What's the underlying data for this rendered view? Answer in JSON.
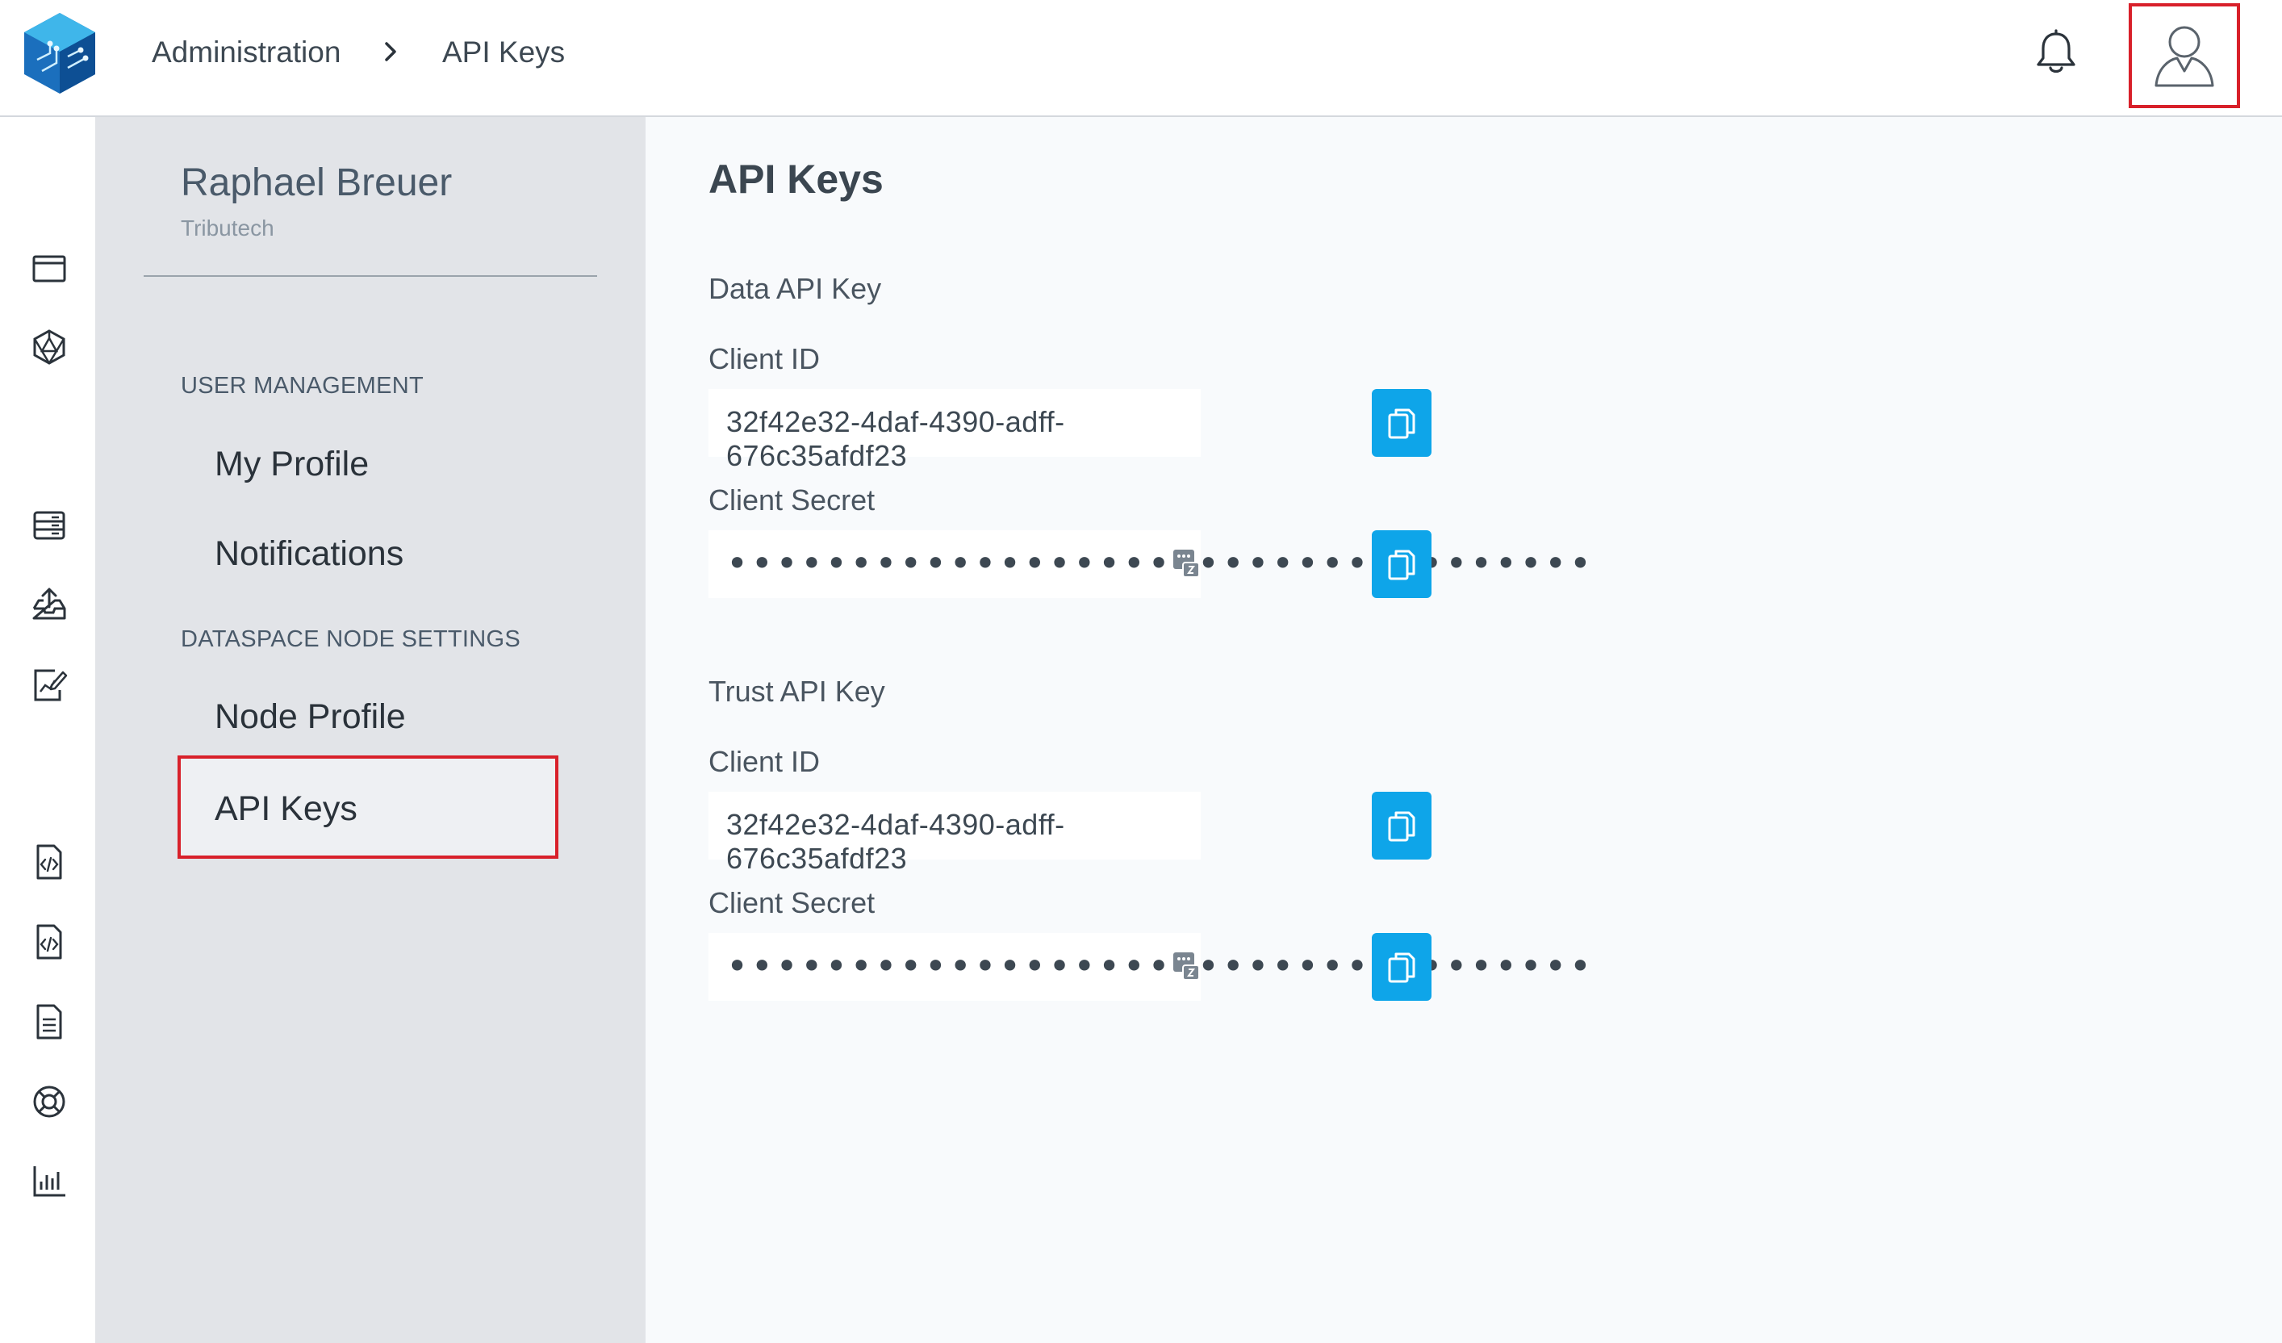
{
  "breadcrumb": {
    "parent": "Administration",
    "current": "API Keys"
  },
  "user": {
    "name": "Raphael Breuer",
    "organization": "Tributech"
  },
  "sidebar": {
    "sections": [
      {
        "title": "USER MANAGEMENT",
        "items": [
          "My Profile",
          "Notifications"
        ]
      },
      {
        "title": "DATASPACE NODE SETTINGS",
        "items": [
          "Node Profile",
          "API Keys"
        ]
      }
    ],
    "active_item": "API Keys"
  },
  "main": {
    "title": "API Keys",
    "groups": [
      {
        "label": "Data API Key",
        "client_id_label": "Client ID",
        "client_id": "32f42e32-4daf-4390-adff-676c35afdf23",
        "client_secret_label": "Client Secret",
        "client_secret_mask": "•••••••••••••••••••••••••••••••••••"
      },
      {
        "label": "Trust API Key",
        "client_id_label": "Client ID",
        "client_id": "32f42e32-4daf-4390-adff-676c35afdf23",
        "client_secret_label": "Client Secret",
        "client_secret_mask": "•••••••••••••••••••••••••••••••••••"
      }
    ]
  },
  "icons": {
    "rail": [
      "window-icon",
      "network-hex-icon",
      "server-icon",
      "upload-tray-icon",
      "edit-chart-icon",
      "code-file-icon",
      "code-file-alt-icon",
      "document-icon",
      "lifebuoy-icon",
      "bar-chart-icon"
    ],
    "topbar": [
      "bell-icon",
      "user-icon"
    ]
  },
  "colors": {
    "accent": "#0ea5e9",
    "highlight_border": "#d8202a",
    "sidebar_bg": "#e2e4e8",
    "content_bg": "#f8fafc"
  }
}
